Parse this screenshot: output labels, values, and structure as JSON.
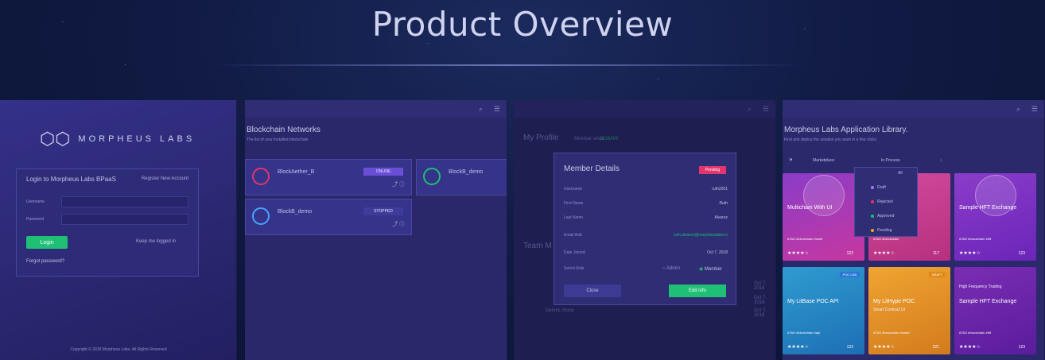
{
  "page": {
    "title": "Product Overview"
  },
  "login_panel": {
    "logo_text": "MORPHEUS LABS",
    "card_title": "Login to Morpheus Labs BPaaS",
    "register": "Register New Account",
    "username_label": "Username",
    "password_label": "Password",
    "login_button": "Login",
    "keep_logged": "Keep me logged in",
    "forgot": "Forgot password?",
    "copyright": "Copyright © 2018 Morpheus Labs. All Rights Reserved"
  },
  "blockchain_panel": {
    "title": "Blockchain Networks",
    "subtitle": "The list of your installed blockchain",
    "networks": [
      {
        "name": "BlockAether_B",
        "badge": "ONLINE",
        "icon_color": "#e0366b"
      },
      {
        "name": "BlockB_demo",
        "badge": "",
        "icon_color": "#1fbf76"
      },
      {
        "name": "BlockB_demo",
        "badge": "STOPPED",
        "icon_color": "#4aa3ff"
      }
    ]
  },
  "profile_panel": {
    "title": "My Profile",
    "member_since_label": "Member since",
    "member_since_value": "2018/4/9",
    "team_title": "Team M",
    "modal": {
      "title": "Member Details",
      "badge": "Pending",
      "rows": [
        {
          "label": "Username",
          "value": "ruth2001"
        },
        {
          "label": "First Name",
          "value": "Ruth"
        },
        {
          "label": "Last Name",
          "value": "Alvarez"
        },
        {
          "label": "Email Add",
          "value": "ruth.alvarez@morpheuslabs.io"
        },
        {
          "label": "Date Joined",
          "value": "Oct 7, 2018"
        }
      ],
      "role_label": "Select Role",
      "role_admin": "Admin",
      "role_member": "Member",
      "close_button": "Close",
      "edit_button": "Edit Info"
    },
    "dates": [
      "Oct 7, 2018",
      "Oct 7, 2018",
      "Oct 7, 2018"
    ],
    "member_name": "Dennis Stone"
  },
  "library_panel": {
    "title": "Morpheus Labs Application Library.",
    "subtitle": "Find and deploy the solution you want in a few clicks",
    "filter1": "Marketplace",
    "filter3": "In Process",
    "dropdown": [
      {
        "label": "All",
        "color": "#c0c2e8"
      },
      {
        "label": "Draft",
        "color": "#a77bff"
      },
      {
        "label": "Rejected",
        "color": "#e0366b"
      },
      {
        "label": "Approved",
        "color": "#1fbf76"
      },
      {
        "label": "Pending",
        "color": "#f5a623"
      }
    ],
    "apps": [
      {
        "title": "Multichain With UI",
        "sub": "",
        "ribbon": "",
        "ribbon_color": "#e0366b",
        "bg": "linear-gradient(160deg,#8a3cc8,#c7379f)",
        "tags": "#TAG  #blockchain  #multi",
        "stars": "★★★★☆",
        "count": "122"
      },
      {
        "title": "",
        "sub": "",
        "ribbon": "",
        "ribbon_color": "#e0366b",
        "bg": "linear-gradient(160deg,#d24a9c,#b7307f)",
        "tags": "#TAG  #blockchain",
        "stars": "★★★★☆",
        "count": "117"
      },
      {
        "title": "Sample HFT Exchange",
        "sub": "",
        "ribbon": "",
        "ribbon_color": "#e0366b",
        "bg": "linear-gradient(160deg,#8b3cc9,#6a25b8)",
        "tags": "#TAG  #blockchain  #hft",
        "stars": "★★★★☆",
        "count": "123"
      },
      {
        "title": "My LitBase POC API",
        "sub": "",
        "ribbon": "POC LAB",
        "ribbon_color": "#2b78d6",
        "bg": "linear-gradient(160deg,#2f9bd0,#1d6fb5)",
        "tags": "#TAG  #blockchain  #api",
        "stars": "★★★★☆",
        "count": "122"
      },
      {
        "title": "My LitHype POC",
        "sub": "Smart Contract UI",
        "ribbon": "DRAFT",
        "ribbon_color": "#e08a1a",
        "bg": "linear-gradient(160deg,#f0a431,#d27b1d)",
        "tags": "#TAG  #blockchain  #smart",
        "stars": "★★★★☆",
        "count": "221"
      },
      {
        "title": "Sample HFT Exchange",
        "sub": "High Frequency Trading",
        "ribbon": "",
        "ribbon_color": "#e0366b",
        "bg": "linear-gradient(160deg,#7a2db4,#5a1c9c)",
        "tags": "#TAG  #blockchain  #hft",
        "stars": "★★★★☆",
        "count": "123"
      }
    ]
  }
}
